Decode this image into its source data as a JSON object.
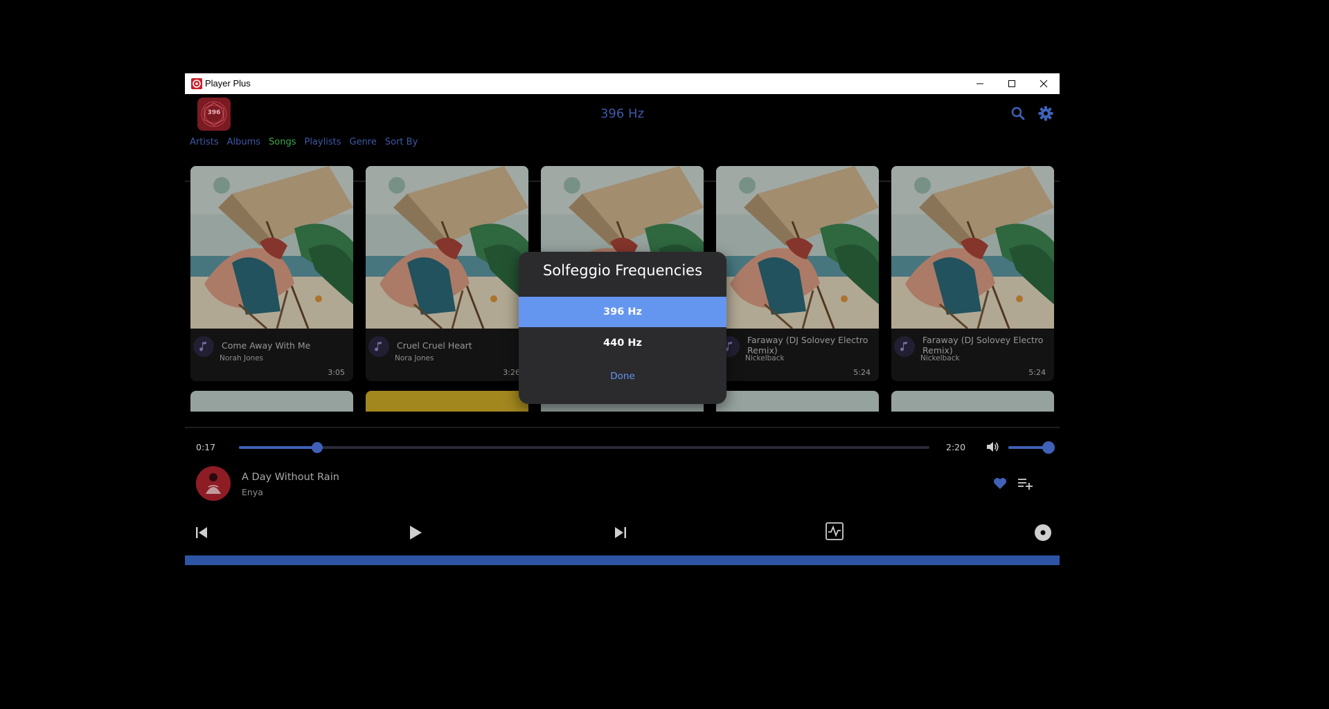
{
  "window": {
    "title": "Player Plus"
  },
  "header": {
    "logo_text": "396",
    "frequency": "396 Hz",
    "nav": [
      {
        "label": "Artists",
        "active": false
      },
      {
        "label": "Albums",
        "active": false
      },
      {
        "label": "Songs",
        "active": true
      },
      {
        "label": "Playlists",
        "active": false
      },
      {
        "label": "Genre",
        "active": false
      },
      {
        "label": "Sort By",
        "active": false
      }
    ]
  },
  "songs": [
    {
      "title": "Come Away With Me",
      "artist": "Norah Jones",
      "duration": "3:05"
    },
    {
      "title": "Cruel Cruel Heart",
      "artist": "Nora Jones",
      "duration": "3:26"
    },
    {
      "title": "",
      "artist": "",
      "duration": ""
    },
    {
      "title": "Faraway (DJ Solovey Electro Remix)",
      "artist": "Nickelback",
      "duration": "5:24"
    },
    {
      "title": "Faraway (DJ Solovey Electro Remix)",
      "artist": "Nickelback",
      "duration": "5:24"
    }
  ],
  "player": {
    "elapsed": "0:17",
    "total": "2:20",
    "progress_fraction": 0.113,
    "volume_fraction": 0.9,
    "track_title": "A Day Without Rain",
    "track_artist": "Enya",
    "liked": true
  },
  "dialog": {
    "title": "Solfeggio Frequencies",
    "options": [
      {
        "label": "396 Hz",
        "selected": true
      },
      {
        "label": "440 Hz",
        "selected": false
      }
    ],
    "done_label": "Done"
  },
  "colors": {
    "accent": "#3f62b8",
    "dialog_selected": "#6596ef",
    "nav_link": "#3f58a6",
    "nav_active": "#3fa84a",
    "footer": "#2e55a5"
  }
}
